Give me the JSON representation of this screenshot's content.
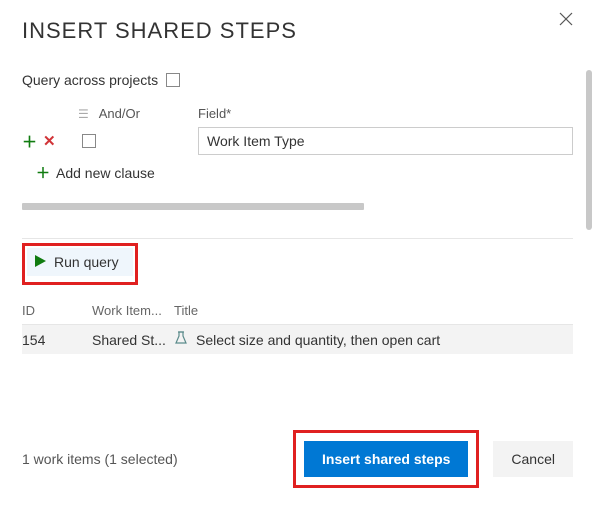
{
  "dialog": {
    "title": "INSERT SHARED STEPS"
  },
  "query": {
    "across_projects_label": "Query across projects",
    "headers": {
      "andor": "And/Or",
      "field": "Field*"
    },
    "field_value": "Work Item Type",
    "add_clause_label": "Add new clause",
    "run_label": "Run query"
  },
  "table": {
    "headers": {
      "id": "ID",
      "work_item": "Work Item...",
      "title": "Title"
    },
    "rows": [
      {
        "id": "154",
        "work_item": "Shared St...",
        "title": "Select size and quantity, then open cart"
      }
    ]
  },
  "footer": {
    "status": "1 work items (1 selected)",
    "insert_label": "Insert shared steps",
    "cancel_label": "Cancel"
  }
}
